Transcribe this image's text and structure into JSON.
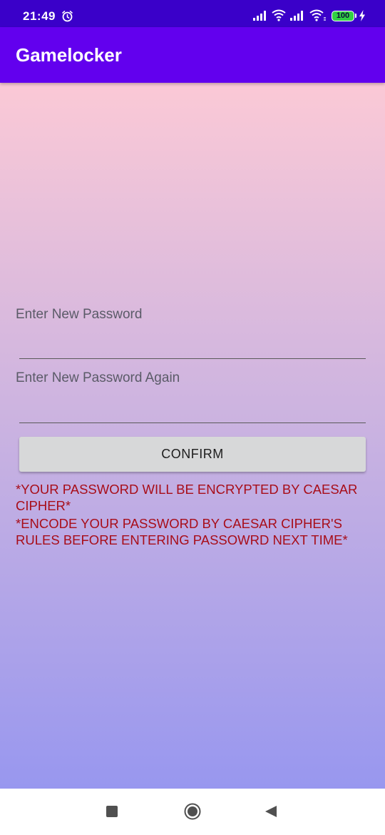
{
  "status_bar": {
    "time": "21:49",
    "battery": "100",
    "icons": [
      "alarm-icon",
      "signal-icon",
      "wifi-icon",
      "signal-icon",
      "wifi-icon",
      "battery-icon",
      "charging-bolt-icon"
    ],
    "background_color": "#3a00c9"
  },
  "app_bar": {
    "title": "Gamelocker",
    "background_color": "#6200ee"
  },
  "form": {
    "password_label": "Enter New Password",
    "password_value": "",
    "password_again_label": "Enter New Password Again",
    "password_again_value": "",
    "confirm_label": "CONFIRM",
    "warning_1": "*YOUR PASSWORD WILL BE ENCRYPTED BY CAESAR CIPHER*",
    "warning_2": "*ENCODE YOUR PASSWORD BY CAESAR CIPHER'S RULES BEFORE ENTERING PASSOWRD NEXT TIME*",
    "warning_color": "#a80d19"
  },
  "nav_bar": {
    "icons": [
      "recent-apps-icon",
      "home-icon",
      "back-icon"
    ]
  }
}
